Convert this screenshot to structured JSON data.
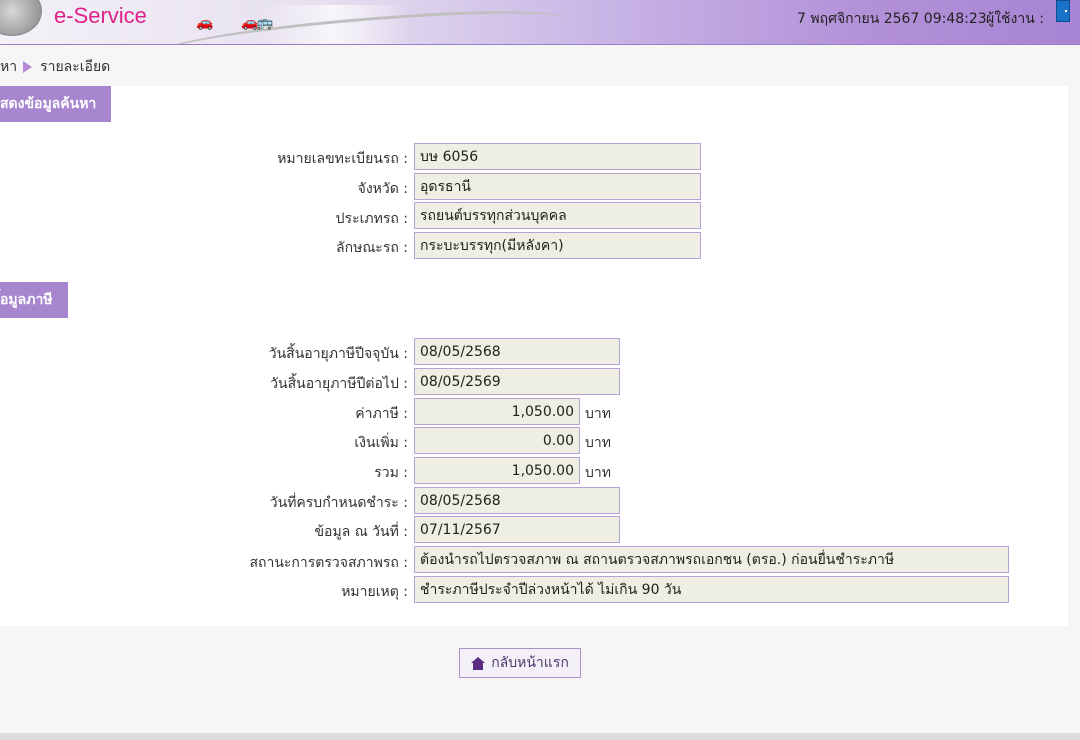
{
  "header": {
    "logo_text": "e-Service",
    "datetime": "7 พฤศจิกายน 2567 09:48:23",
    "user_label": "ผู้ใช้งาน :"
  },
  "breadcrumb": {
    "first": "หา",
    "current": "รายละเอียด"
  },
  "vehicle_section": {
    "title": "สดงข้อมูลค้นหา",
    "fields": [
      {
        "label": "หมายเลขทะเบียนรถ :",
        "value": "บษ 6056"
      },
      {
        "label": "จังหวัด :",
        "value": "อุดรธานี"
      },
      {
        "label": "ประเภทรถ :",
        "value": "รถยนต์บรรทุกส่วนบุคคล"
      },
      {
        "label": "ลักษณะรถ :",
        "value": "กระบะบรรทุก(มีหลังคา)"
      }
    ]
  },
  "tax_section": {
    "title": "้อมูลภาษี",
    "expire_current": {
      "label": "วันสิ้นอายุภาษีปีจจุบัน :",
      "value": "08/05/2568"
    },
    "expire_next": {
      "label": "วันสิ้นอายุภาษีปีต่อไป :",
      "value": "08/05/2569"
    },
    "tax_amount": {
      "label": "ค่าภาษี :",
      "value": "1,050.00",
      "unit": "บาท"
    },
    "surcharge": {
      "label": "เงินเพิ่ม :",
      "value": "0.00",
      "unit": "บาท"
    },
    "total": {
      "label": "รวม :",
      "value": "1,050.00",
      "unit": "บาท"
    },
    "due_date": {
      "label": "วันที่ครบกำหนดชำระ :",
      "value": "08/05/2568"
    },
    "data_date": {
      "label": "ข้อมูล ณ วันที่ :",
      "value": "07/11/2567"
    },
    "inspection": {
      "label": "สถานะการตรวจสภาพรถ :",
      "value": "ต้องนำรถไปตรวจสภาพ ณ สถานตรวจสภาพรถเอกชน (ตรอ.) ก่อนยื่นชำระภาษี"
    },
    "remark": {
      "label": "หมายเหตุ :",
      "value": "ชำระภาษีประจำปีล่วงหน้าได้ ไม่เกิน 90 วัน"
    }
  },
  "home_button": {
    "label": "กลับหน้าแรก"
  }
}
